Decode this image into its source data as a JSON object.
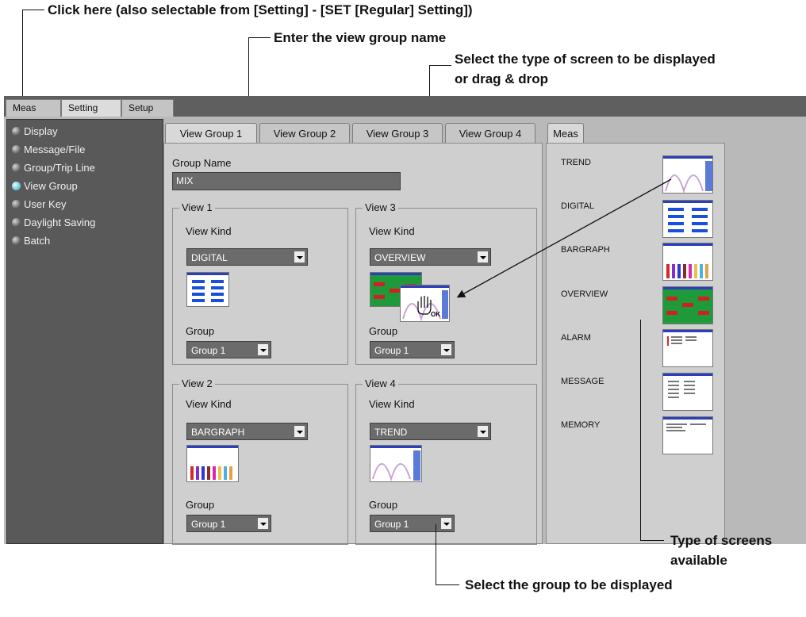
{
  "annotations": {
    "click_here": "Click here (also selectable from [Setting] - [SET [Regular] Setting])",
    "enter_name": "Enter the view group name",
    "select_type_1": "Select the type of screen to be displayed",
    "select_type_2": "or drag & drop",
    "types_1": "Type of screens",
    "types_2": "available",
    "select_group": "Select the group to be displayed"
  },
  "top_tabs": [
    "Meas",
    "Setting",
    "Setup"
  ],
  "sidebar": {
    "items": [
      {
        "label": "Display",
        "selected": false
      },
      {
        "label": "Message/File",
        "selected": false
      },
      {
        "label": "Group/Trip Line",
        "selected": false
      },
      {
        "label": "View Group",
        "selected": true
      },
      {
        "label": "User Key",
        "selected": false
      },
      {
        "label": "Daylight Saving",
        "selected": false
      },
      {
        "label": "Batch",
        "selected": false
      }
    ]
  },
  "view_group_tabs": [
    "View Group 1",
    "View Group 2",
    "View Group 3",
    "View Group 4"
  ],
  "group_name": {
    "label": "Group Name",
    "value": "MIX"
  },
  "views": {
    "v1": {
      "title": "View 1",
      "kind_label": "View Kind",
      "kind": "DIGITAL",
      "group_label": "Group",
      "group": "Group 1"
    },
    "v2": {
      "title": "View 2",
      "kind_label": "View Kind",
      "kind": "BARGRAPH",
      "group_label": "Group",
      "group": "Group 1"
    },
    "v3": {
      "title": "View 3",
      "kind_label": "View Kind",
      "kind": "OVERVIEW",
      "group_label": "Group",
      "group": "Group 1",
      "drag_label": "OK"
    },
    "v4": {
      "title": "View 4",
      "kind_label": "View Kind",
      "kind": "TREND",
      "group_label": "Group",
      "group": "Group 1"
    }
  },
  "meas_panel": {
    "tab": "Meas",
    "screens": [
      "TREND",
      "DIGITAL",
      "BARGRAPH",
      "OVERVIEW",
      "ALARM",
      "MESSAGE",
      "MEMORY"
    ]
  },
  "colors": {
    "app_bg": "#b9b9b9",
    "sidebar_bg": "#595959",
    "field_bg": "#6b6b6b",
    "selected_dot": "#2aa5c6",
    "thumb_header": "#2b3fb8"
  },
  "icons": [
    "radio-dot-icon",
    "dropdown-arrow-icon",
    "hand-cursor-icon"
  ]
}
